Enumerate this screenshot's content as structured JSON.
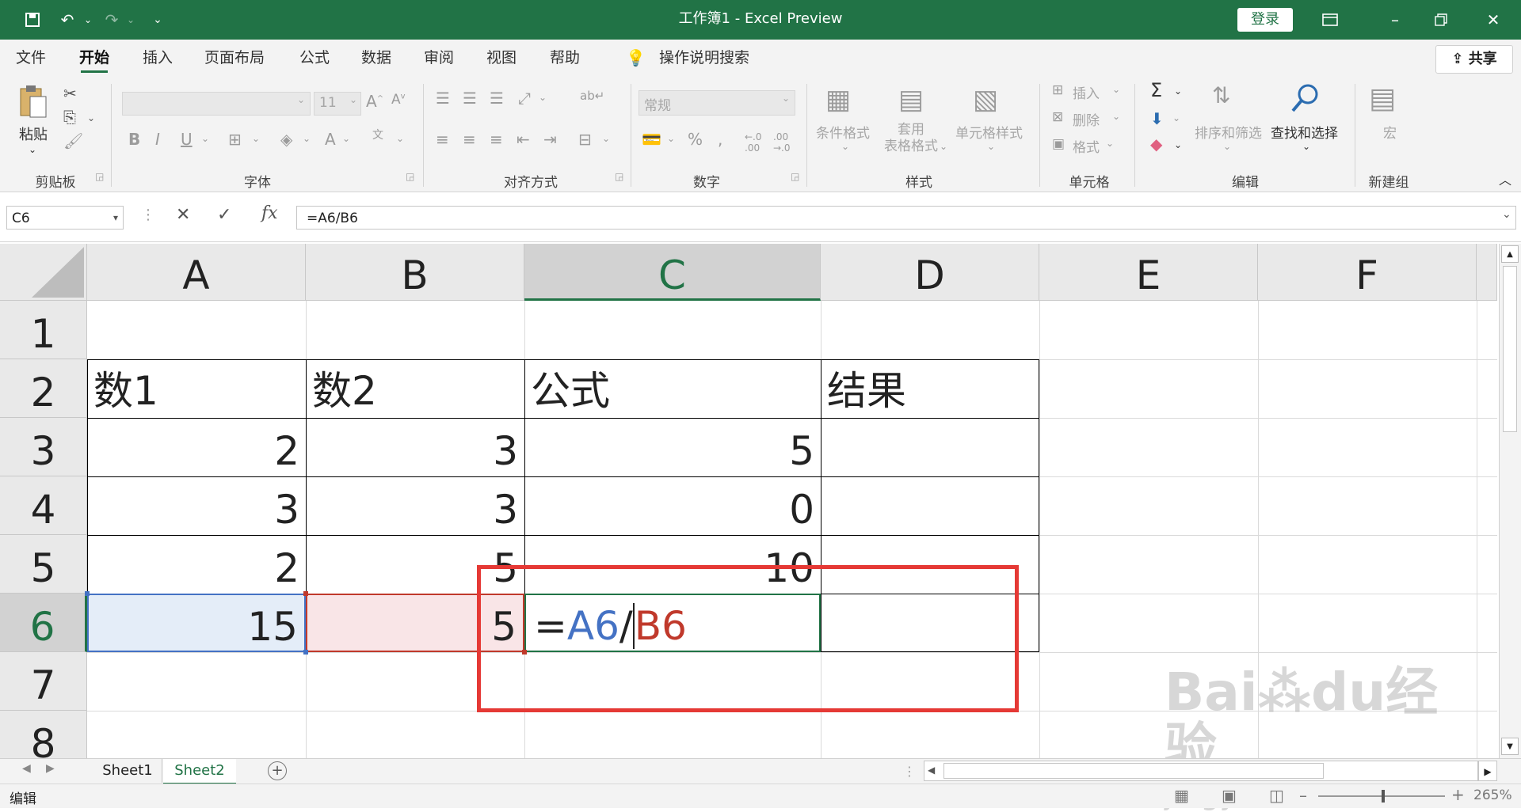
{
  "window": {
    "title": "工作簿1  -  Excel Preview",
    "login_label": "登录"
  },
  "tabs": [
    {
      "label": "文件"
    },
    {
      "label": "开始"
    },
    {
      "label": "插入"
    },
    {
      "label": "页面布局"
    },
    {
      "label": "公式"
    },
    {
      "label": "数据"
    },
    {
      "label": "审阅"
    },
    {
      "label": "视图"
    },
    {
      "label": "帮助"
    }
  ],
  "tell_me": "操作说明搜索",
  "share_label": "共享",
  "ribbon": {
    "paste_label": "粘贴",
    "font_name": "",
    "font_size": "11",
    "number_format": "常规",
    "cond_format_label": "条件格式",
    "table_format_label": "套用\n表格格式",
    "cell_style_label": "单元格样式",
    "insert_label": "插入",
    "delete_label": "删除",
    "format_label": "格式",
    "sort_filter_label": "排序和筛选",
    "find_select_label": "查找和选择",
    "macro_label": "宏",
    "groups": {
      "clipboard": "剪贴板",
      "font": "字体",
      "alignment": "对齐方式",
      "number": "数字",
      "styles": "样式",
      "cells": "单元格",
      "editing": "编辑",
      "new_group": "新建组"
    }
  },
  "formula_bar": {
    "name_box": "C6",
    "formula": "=A6/B6"
  },
  "columns": [
    "A",
    "B",
    "C",
    "D",
    "E",
    "F"
  ],
  "rows": [
    "1",
    "2",
    "3",
    "4",
    "5",
    "6",
    "7",
    "8"
  ],
  "table": {
    "headers": [
      "数1",
      "数2",
      "公式",
      "结果"
    ],
    "data": [
      {
        "a": "2",
        "b": "3",
        "c": "5"
      },
      {
        "a": "3",
        "b": "3",
        "c": "0"
      },
      {
        "a": "2",
        "b": "5",
        "c": "10"
      },
      {
        "a": "15",
        "b": "5",
        "c_eq": "=",
        "c_ref1": "A6",
        "c_op": "/",
        "c_ref2": "B6"
      }
    ]
  },
  "sheets": [
    {
      "label": "Sheet1"
    },
    {
      "label": "Sheet2"
    }
  ],
  "status": {
    "mode": "编辑",
    "zoom": "265%"
  },
  "watermark": "Baidu经验 jingyan.baidu.com",
  "colors": {
    "excel_green": "#217346",
    "ref_blue": "#4472c4",
    "ref_red": "#c0392b",
    "highlight": "#e53935"
  }
}
